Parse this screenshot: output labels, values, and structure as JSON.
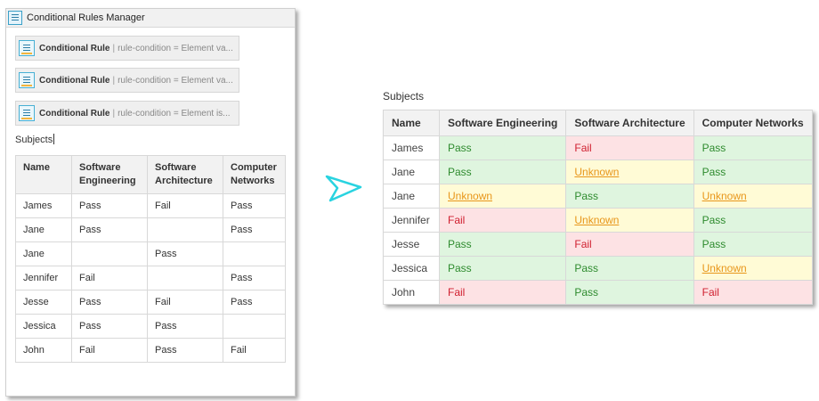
{
  "manager": {
    "title": "Conditional Rules Manager",
    "rules": [
      {
        "title": "Conditional Rule",
        "separator": "|",
        "condition": "rule-condition = Element va..."
      },
      {
        "title": "Conditional Rule",
        "separator": "|",
        "condition": "rule-condition = Element va..."
      },
      {
        "title": "Conditional Rule",
        "separator": "|",
        "condition": "rule-condition = Element is..."
      }
    ]
  },
  "source": {
    "caption": "Subjects",
    "headers": [
      "Name",
      "Software Engineering",
      "Software Architecture",
      "Computer Networks"
    ],
    "rows": [
      [
        "James",
        "Pass",
        "Fail",
        "Pass"
      ],
      [
        "Jane",
        "Pass",
        "",
        "Pass"
      ],
      [
        "Jane",
        "",
        "Pass",
        ""
      ],
      [
        "Jennifer",
        "Fail",
        "",
        "Pass"
      ],
      [
        "Jesse",
        "Pass",
        "Fail",
        "Pass"
      ],
      [
        "Jessica",
        "Pass",
        "Pass",
        ""
      ],
      [
        "John",
        "Fail",
        "Pass",
        "Fail"
      ]
    ]
  },
  "result": {
    "caption": "Subjects",
    "headers": [
      "Name",
      "Software Engineering",
      "Software Architecture",
      "Computer Networks"
    ],
    "rows": [
      [
        "James",
        "Pass",
        "Fail",
        "Pass"
      ],
      [
        "Jane",
        "Pass",
        "Unknown",
        "Pass"
      ],
      [
        "Jane",
        "Unknown",
        "Pass",
        "Unknown"
      ],
      [
        "Jennifer",
        "Fail",
        "Unknown",
        "Pass"
      ],
      [
        "Jesse",
        "Pass",
        "Fail",
        "Pass"
      ],
      [
        "Jessica",
        "Pass",
        "Pass",
        "Unknown"
      ],
      [
        "John",
        "Fail",
        "Pass",
        "Fail"
      ]
    ],
    "colors": {
      "pass_bg": "#dff5df",
      "pass_text": "#2e8b2e",
      "fail_bg": "#fde2e4",
      "fail_text": "#d02030",
      "unknown_bg": "#fffbd6",
      "unknown_text": "#e8961a"
    }
  },
  "arrow": {
    "color": "#29d3e0",
    "icon": "send-arrow-icon"
  }
}
